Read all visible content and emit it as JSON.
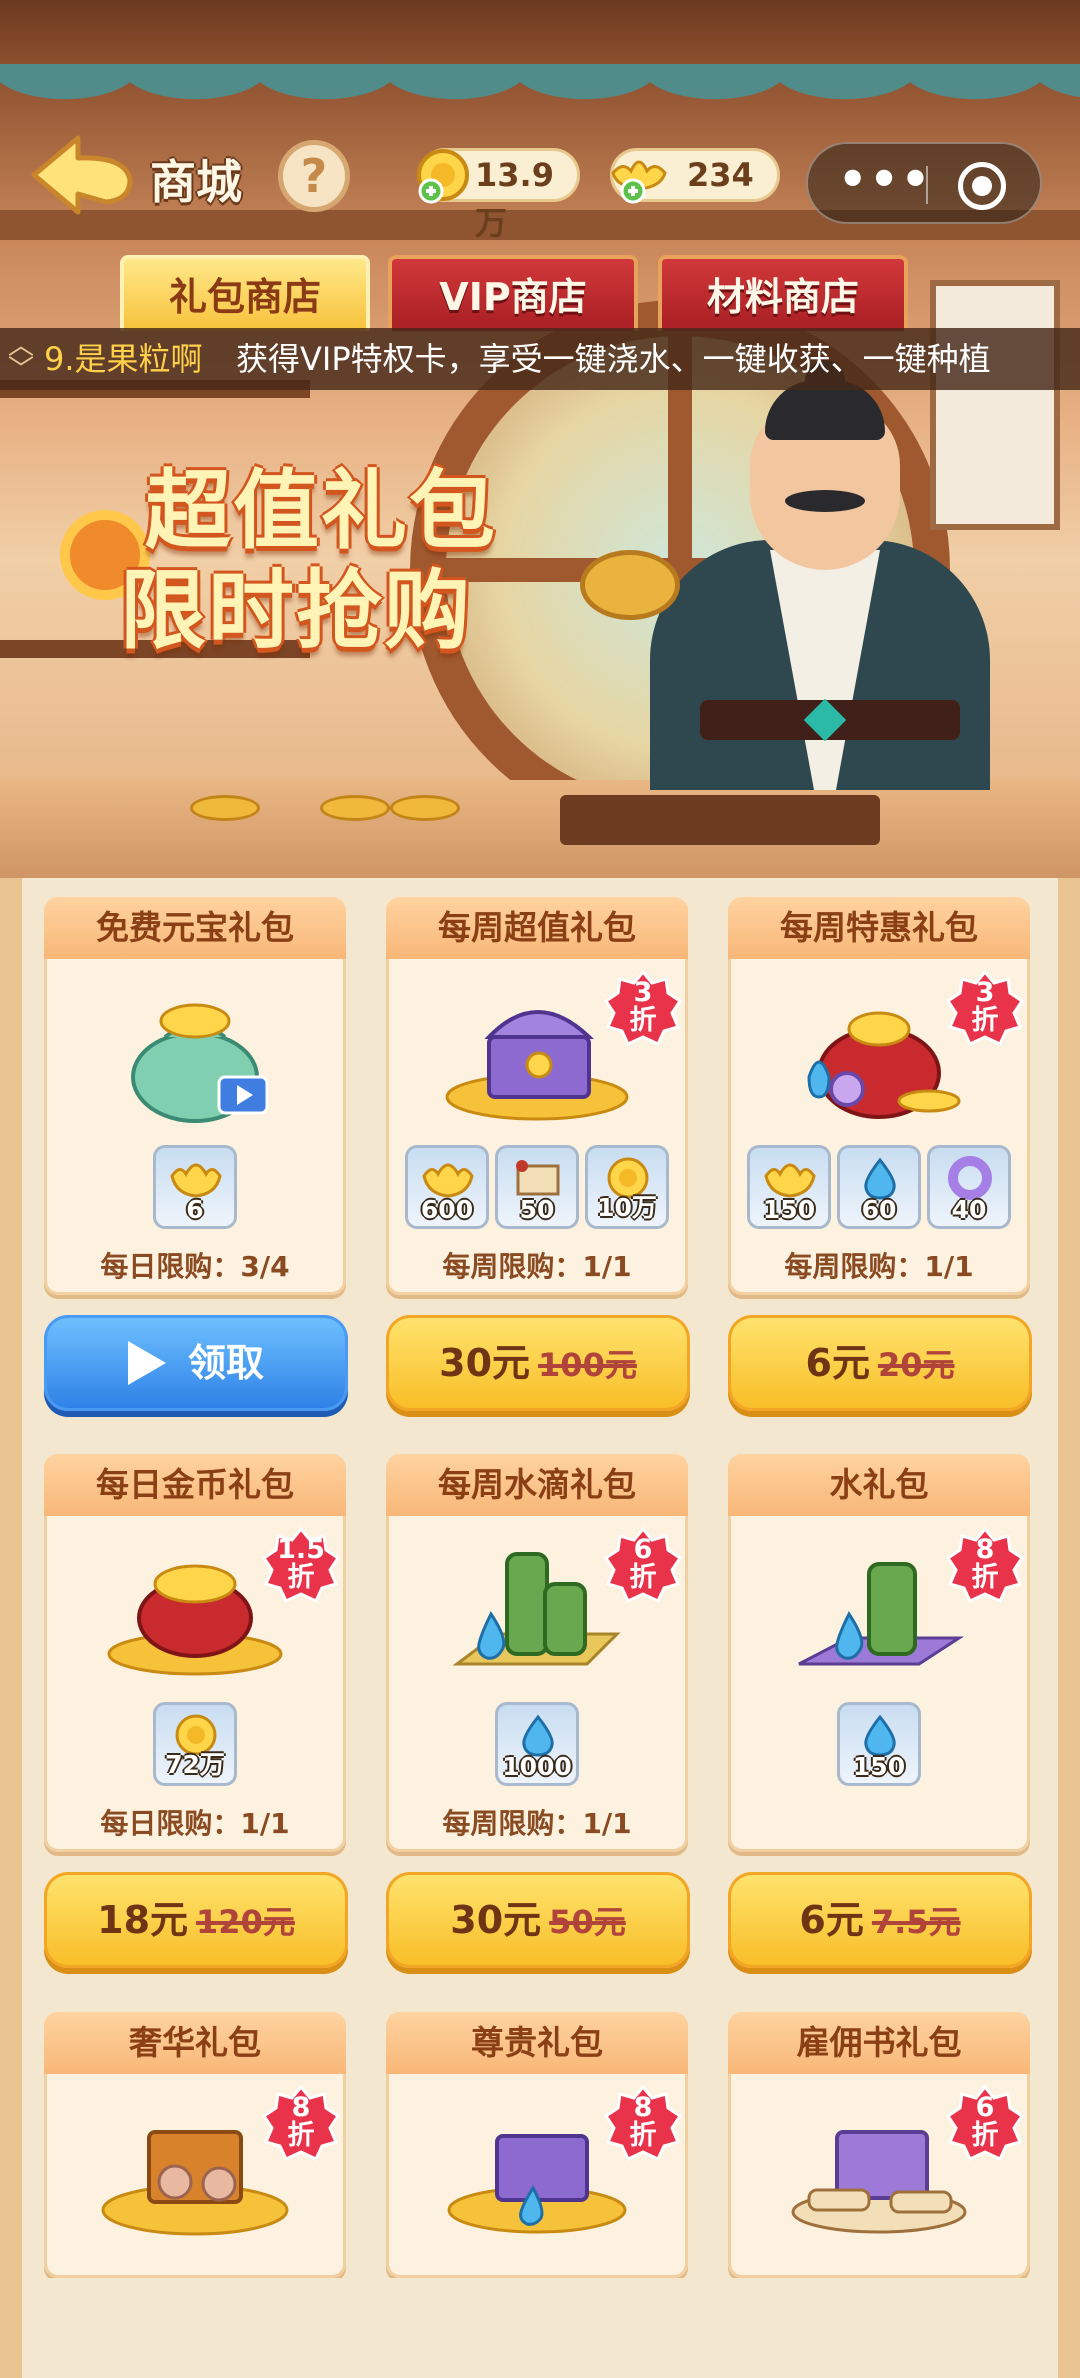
{
  "header": {
    "title": "商城",
    "help_glyph": "?",
    "coins": "13.9万",
    "ingots": "234",
    "menu_dots": "•••"
  },
  "tabs": [
    {
      "label": "礼包商店",
      "active": true
    },
    {
      "label": "VIP商店",
      "active": false
    },
    {
      "label": "材料商店",
      "active": false
    }
  ],
  "marquee": {
    "user": "9.是果粒啊",
    "message": "获得VIP特权卡，享受一键浇水、一键收获、一键种植"
  },
  "promo": {
    "line1": "超值礼包",
    "line2": "限时抢购"
  },
  "colors": {
    "tab_active": "#f7c23b",
    "tab_inactive": "#c0282c",
    "buy_button": "#f8bd26",
    "claim_button": "#2d7fe6",
    "discount_badge": "#e8334a"
  },
  "packs": [
    {
      "name": "免费元宝礼包",
      "icon": "money-bag-icon",
      "badge": null,
      "items": [
        {
          "icon": "gold-ingot-icon",
          "qty": "6"
        }
      ],
      "limit": "每日限购：3/4",
      "button": {
        "type": "claim",
        "label": "领取"
      }
    },
    {
      "name": "每周超值礼包",
      "icon": "treasure-chest-icon",
      "badge": {
        "n": "3",
        "unit": "折"
      },
      "items": [
        {
          "icon": "gold-ingot-icon",
          "qty": "600"
        },
        {
          "icon": "scroll-icon",
          "qty": "50"
        },
        {
          "icon": "gold-coin-icon",
          "qty": "10万"
        }
      ],
      "limit": "每周限购：1/1",
      "button": {
        "type": "buy",
        "price": "30元",
        "old": "100元"
      }
    },
    {
      "name": "每周特惠礼包",
      "icon": "red-treasure-bag-icon",
      "badge": {
        "n": "3",
        "unit": "折"
      },
      "items": [
        {
          "icon": "gold-ingot-icon",
          "qty": "150"
        },
        {
          "icon": "water-drop-icon",
          "qty": "60"
        },
        {
          "icon": "purple-ring-icon",
          "qty": "40"
        }
      ],
      "limit": "每周限购：1/1",
      "button": {
        "type": "buy",
        "price": "6元",
        "old": "20元"
      }
    },
    {
      "name": "每日金币礼包",
      "icon": "coin-bag-icon",
      "badge": {
        "n": "1.5",
        "unit": "折"
      },
      "items": [
        {
          "icon": "gold-coin-icon",
          "qty": "72万"
        }
      ],
      "limit": "每日限购：1/1",
      "button": {
        "type": "buy",
        "price": "18元",
        "old": "120元"
      }
    },
    {
      "name": "每周水滴礼包",
      "icon": "bamboo-water-icon",
      "badge": {
        "n": "6",
        "unit": "折"
      },
      "items": [
        {
          "icon": "water-drop-icon",
          "qty": "1000"
        }
      ],
      "limit": "每周限购：1/1",
      "button": {
        "type": "buy",
        "price": "30元",
        "old": "50元"
      }
    },
    {
      "name": "水礼包",
      "icon": "bamboo-water-icon",
      "badge": {
        "n": "8",
        "unit": "折"
      },
      "items": [
        {
          "icon": "water-drop-icon",
          "qty": "150"
        }
      ],
      "limit": "",
      "button": {
        "type": "buy",
        "price": "6元",
        "old": "7.5元"
      }
    },
    {
      "name": "奢华礼包",
      "icon": "luxury-chest-icon",
      "badge": {
        "n": "8",
        "unit": "折"
      }
    },
    {
      "name": "尊贵礼包",
      "icon": "noble-chest-icon",
      "badge": {
        "n": "8",
        "unit": "折"
      }
    },
    {
      "name": "雇佣书礼包",
      "icon": "scroll-chest-icon",
      "badge": {
        "n": "6",
        "unit": "折"
      }
    }
  ]
}
